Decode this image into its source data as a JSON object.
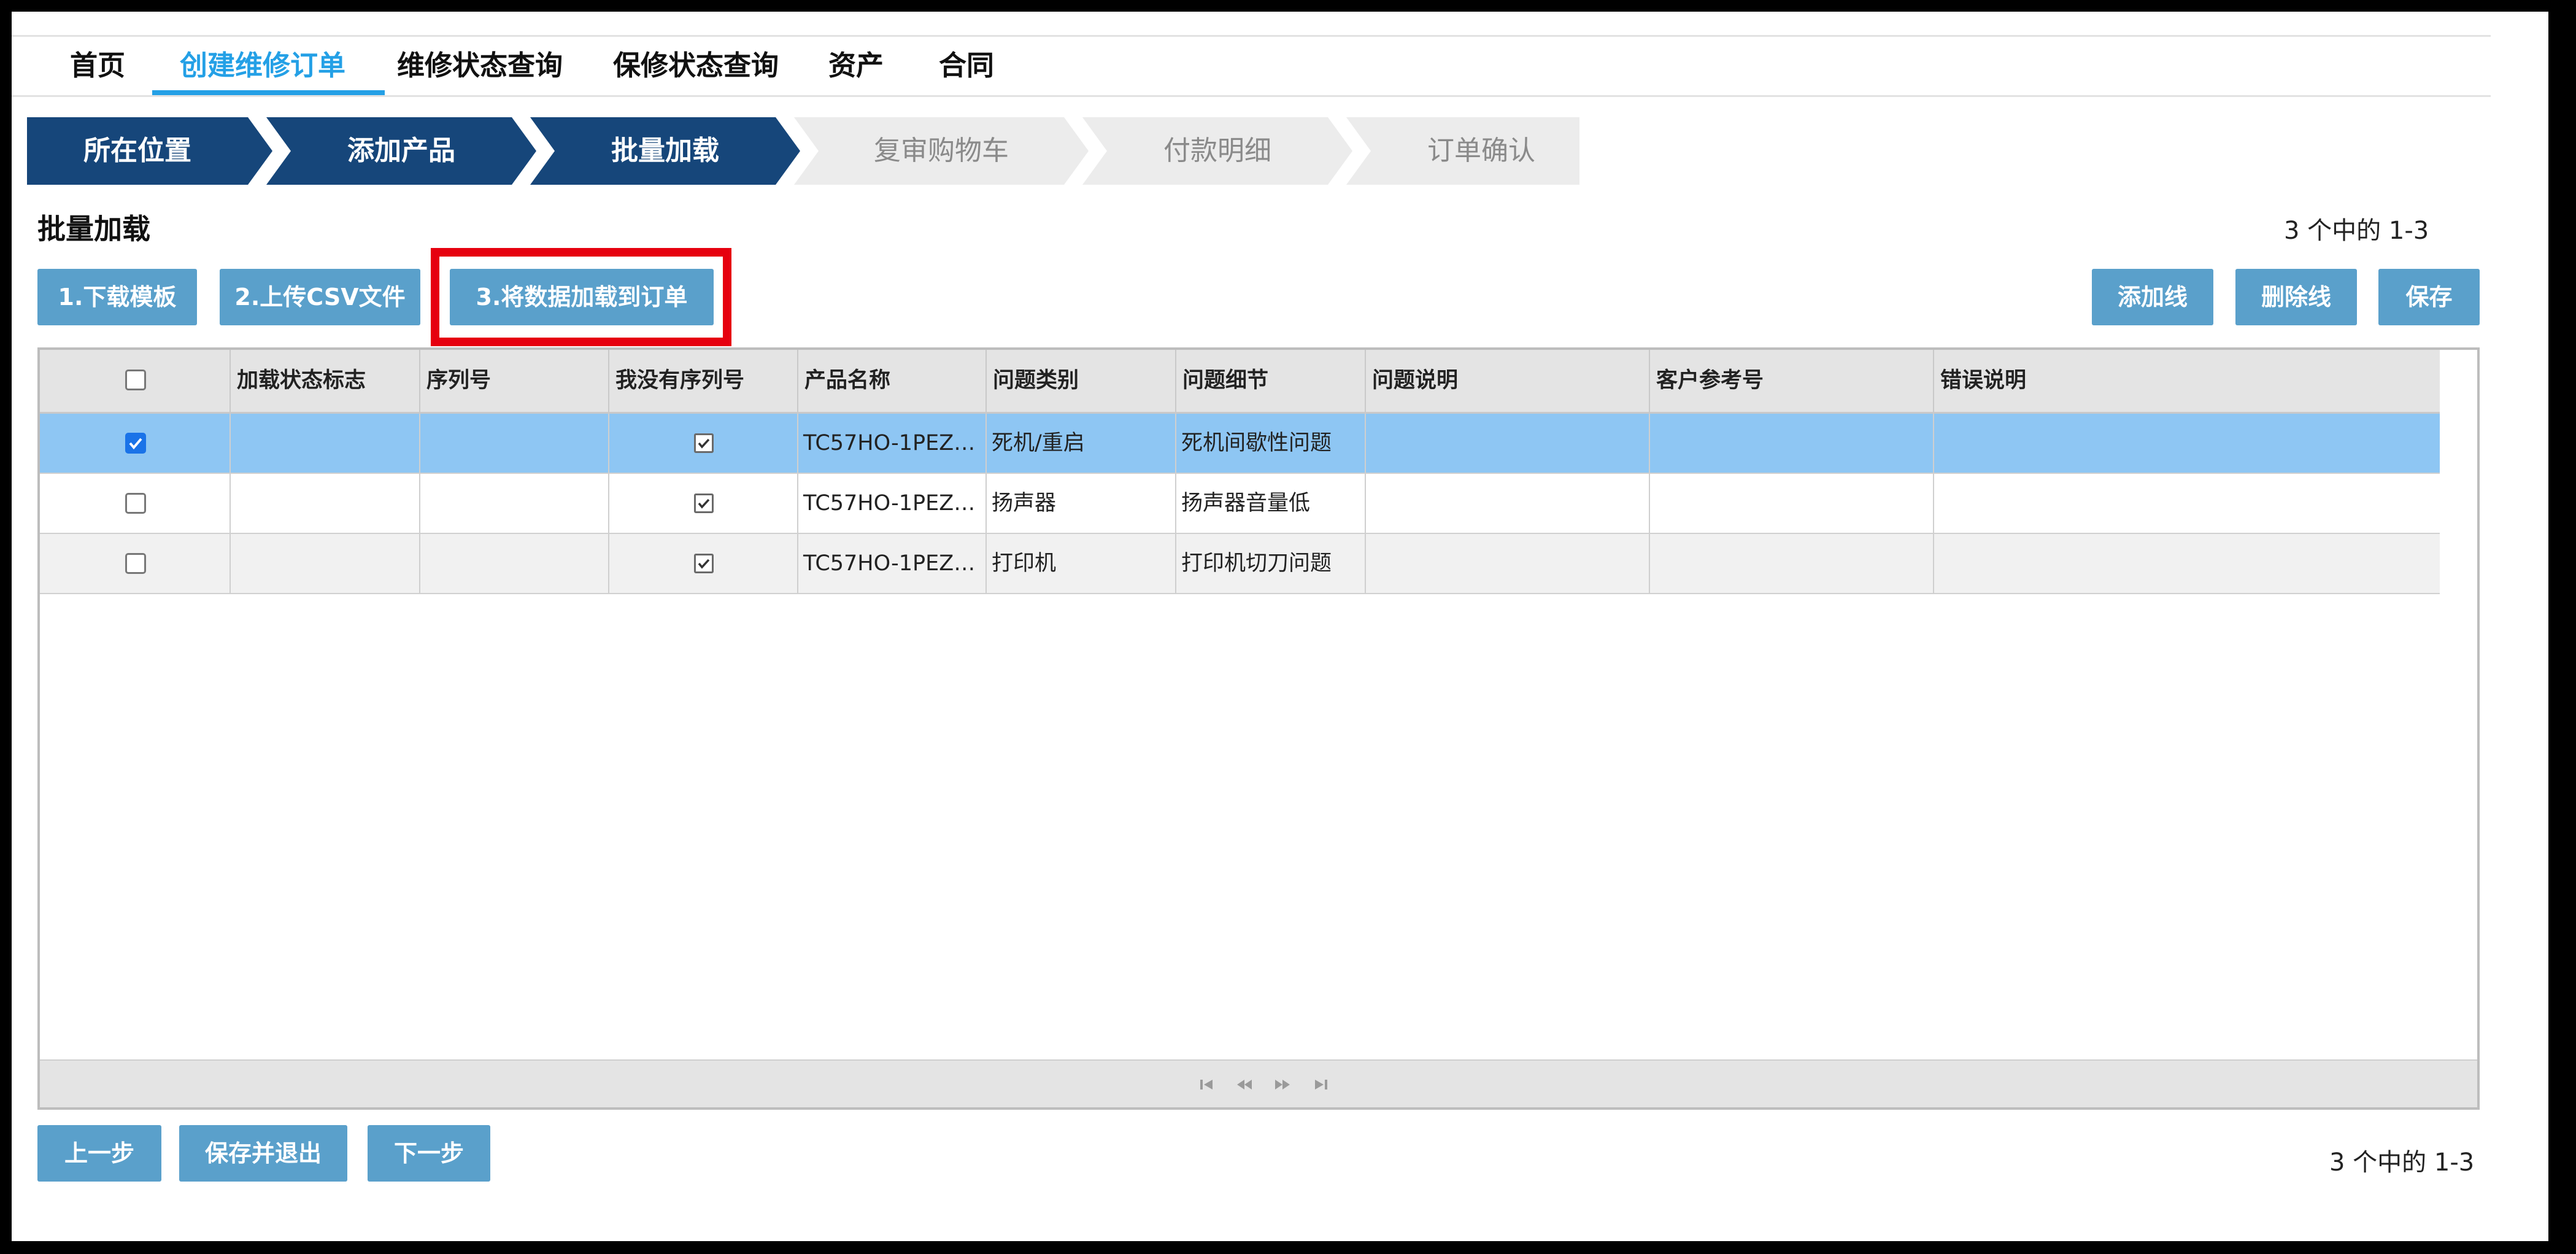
{
  "nav": {
    "items": [
      {
        "label": "首页"
      },
      {
        "label": "创建维修订单"
      },
      {
        "label": "维修状态查询"
      },
      {
        "label": "保修状态查询"
      },
      {
        "label": "资产"
      },
      {
        "label": "合同"
      }
    ],
    "active_index": 1
  },
  "wizard": {
    "steps": [
      {
        "label": "所在位置",
        "state": "done"
      },
      {
        "label": "添加产品",
        "state": "done"
      },
      {
        "label": "批量加载",
        "state": "current"
      },
      {
        "label": "复审购物车",
        "state": "pending"
      },
      {
        "label": "付款明细",
        "state": "pending"
      },
      {
        "label": "订单确认",
        "state": "pending"
      }
    ]
  },
  "section": {
    "title": "批量加载",
    "count_top": "3 个中的 1-3",
    "count_bottom": "3 个中的 1-3"
  },
  "actions": {
    "download_template": "1.下载模板",
    "upload_csv": "2.上传CSV文件",
    "load_to_order": "3.将数据加载到订单",
    "add_line": "添加线",
    "delete_line": "删除线",
    "save": "保存"
  },
  "table": {
    "columns": [
      "加载状态标志",
      "序列号",
      "我没有序列号",
      "产品名称",
      "问题类别",
      "问题细节",
      "问题说明",
      "客户参考号",
      "错误说明"
    ],
    "rows": [
      {
        "selected": true,
        "load_status": "",
        "serial": "",
        "no_serial": true,
        "product": "TC57HO-1PEZU...",
        "category": "死机/重启",
        "detail": "死机间歇性问题",
        "description": "",
        "customer_ref": "",
        "error": ""
      },
      {
        "selected": false,
        "load_status": "",
        "serial": "",
        "no_serial": true,
        "product": "TC57HO-1PEZU...",
        "category": "扬声器",
        "detail": "扬声器音量低",
        "description": "",
        "customer_ref": "",
        "error": ""
      },
      {
        "selected": false,
        "load_status": "",
        "serial": "",
        "no_serial": true,
        "product": "TC57HO-1PEZU...",
        "category": "打印机",
        "detail": "打印机切刀问题",
        "description": "",
        "customer_ref": "",
        "error": ""
      }
    ]
  },
  "footer": {
    "prev": "上一步",
    "save_exit": "保存并退出",
    "next": "下一步"
  },
  "colors": {
    "accent": "#24a0e6",
    "step_done": "#16467a",
    "step_pending": "#ececec",
    "button": "#5aa0cb",
    "row_selected": "#8ec6f3",
    "highlight": "#e6000f"
  },
  "icons": {
    "pager": [
      "first-page-icon",
      "prev-page-icon",
      "next-page-icon",
      "last-page-icon"
    ]
  }
}
